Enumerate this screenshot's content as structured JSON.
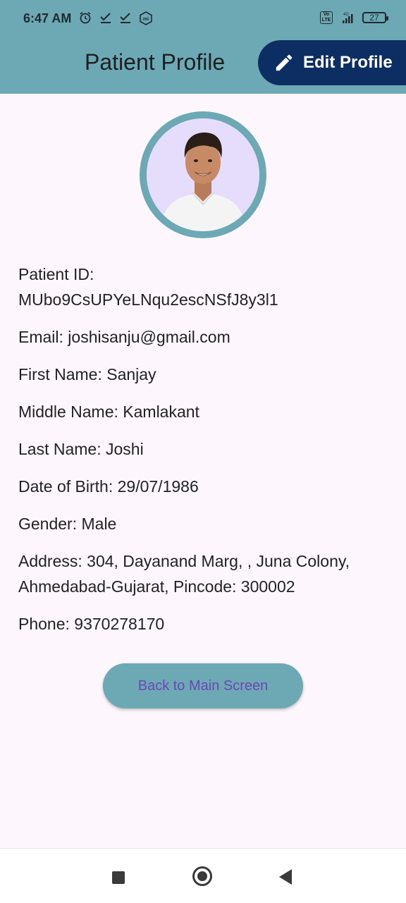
{
  "status_bar": {
    "time": "6:47 AM",
    "network": "4G",
    "lte": "Vo LTE",
    "battery": "27"
  },
  "header": {
    "title": "Patient Profile",
    "edit_button": "Edit Profile"
  },
  "profile": {
    "patient_id_label": "Patient ID:",
    "patient_id": "MUbo9CsUPYeLNqu2escNSfJ8y3l1",
    "email": "Email: joshisanju@gmail.com",
    "first_name": "First Name: Sanjay",
    "middle_name": "Middle Name: Kamlakant",
    "last_name": "Last Name: Joshi",
    "dob": "Date of Birth: 29/07/1986",
    "gender": "Gender: Male",
    "address": "Address: 304, Dayanand Marg, , Juna Colony, Ahmedabad-Gujarat, Pincode: 300002",
    "phone": "Phone: 9370278170"
  },
  "actions": {
    "back_button": "Back to Main Screen"
  },
  "colors": {
    "accent": "#6ca9b5",
    "primary_dark": "#0c2e63",
    "background": "#fdf7fd",
    "button_text": "#6b48b5"
  }
}
